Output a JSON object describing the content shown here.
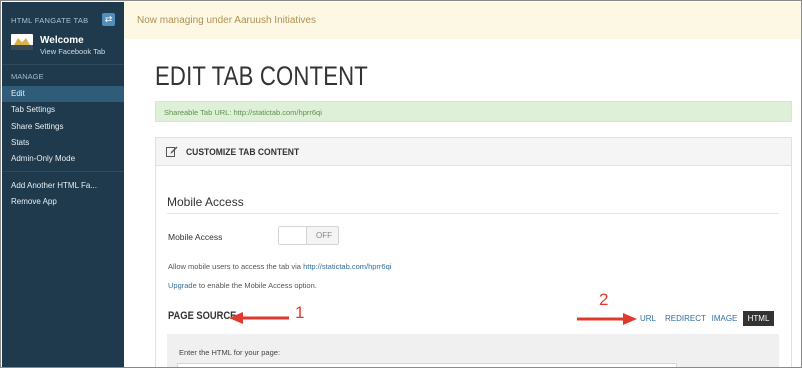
{
  "sidebar": {
    "app_title": "HTML FANGATE TAB",
    "toggle_glyph": "⇄",
    "page_name": "Welcome",
    "view_link": "View Facebook Tab",
    "section_label": "MANAGE",
    "items": [
      {
        "label": "Edit"
      },
      {
        "label": "Tab Settings"
      },
      {
        "label": "Share Settings"
      },
      {
        "label": "Stats"
      },
      {
        "label": "Admin-Only Mode"
      }
    ],
    "extra_items": [
      {
        "label": "Add Another HTML Fa..."
      },
      {
        "label": "Remove App"
      }
    ],
    "active_index": 0
  },
  "topbar": {
    "notice": "Now managing under Aaruush Initiatives"
  },
  "main": {
    "page_title": "EDIT TAB CONTENT",
    "share_text": "Shareable Tab URL: http://statictab.com/hprr6qi",
    "panel_title": "CUSTOMIZE TAB CONTENT",
    "mobile": {
      "heading": "Mobile Access",
      "label": "Mobile Access",
      "toggle_state": "OFF",
      "allow_prefix": "Allow mobile users to access the tab via ",
      "allow_link": "http://statictab.com/hprr6qi",
      "upgrade_link": "Upgrade",
      "upgrade_suffix": " to enable the Mobile Access option."
    },
    "page_source": {
      "heading": "PAGE SOURCE",
      "tabs": [
        {
          "label": "URL"
        },
        {
          "label": "REDIRECT"
        },
        {
          "label": "IMAGE"
        },
        {
          "label": "HTML"
        }
      ],
      "active_tab": "HTML",
      "editor_label": "Enter the HTML for your page:"
    }
  },
  "annotations": {
    "marker_1": "1",
    "marker_2": "2",
    "color": "#e03a2e"
  },
  "colors": {
    "sidebar_bg": "#1f3a4d",
    "sidebar_active": "#2f5d79",
    "notice_bg": "#fcf8e3",
    "share_bg": "#dff0d8",
    "link": "#2f6fa3"
  }
}
